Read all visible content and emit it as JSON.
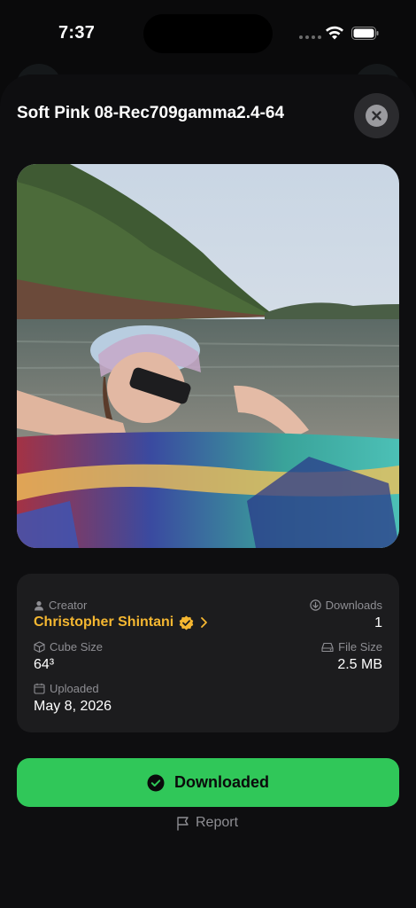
{
  "status": {
    "time": "7:37"
  },
  "sheet": {
    "title": "Soft Pink 08-Rec709gamma2.4-64"
  },
  "info": {
    "creator_label": "Creator",
    "creator_name": "Christopher Shintani",
    "downloads_label": "Downloads",
    "downloads_value": "1",
    "cube_label": "Cube Size",
    "cube_value": "64³",
    "filesize_label": "File Size",
    "filesize_value": "2.5 MB",
    "uploaded_label": "Uploaded",
    "uploaded_value": "May 8, 2026"
  },
  "actions": {
    "download_label": "Downloaded",
    "report_label": "Report"
  },
  "colors": {
    "accent_green": "#30c759",
    "creator_gold": "#f5b731",
    "card_bg": "#1c1c1e",
    "sheet_bg": "#0e0e10"
  },
  "icons": [
    "wifi-icon",
    "battery-icon",
    "close-icon",
    "person-icon",
    "verified-badge-icon",
    "chevron-right-icon",
    "download-circle-icon",
    "cube-icon",
    "drive-icon",
    "calendar-icon",
    "checkmark-circle-icon",
    "flag-icon"
  ]
}
